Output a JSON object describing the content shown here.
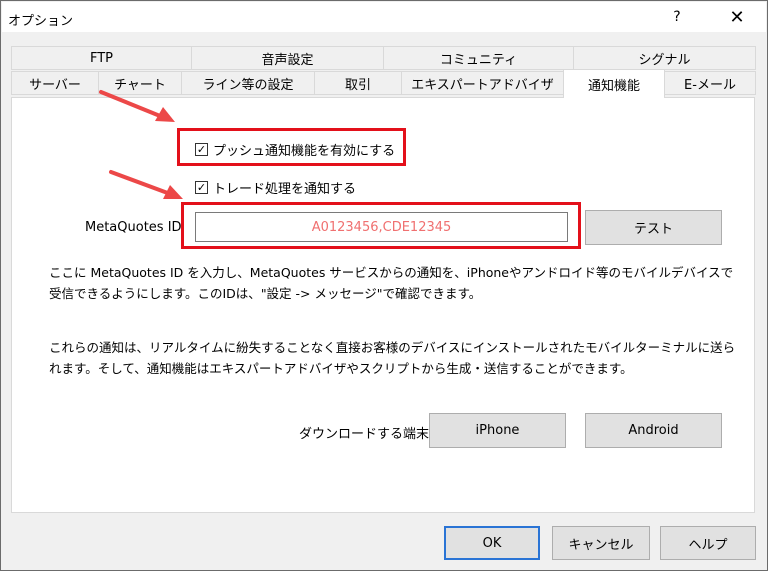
{
  "window": {
    "title": "オプション",
    "help_glyph": "?",
    "close_glyph": "✕"
  },
  "tabs": {
    "row_top": [
      "FTP",
      "音声設定",
      "コミュニティ",
      "シグナル"
    ],
    "row_bottom": [
      "サーバー",
      "チャート",
      "ライン等の設定",
      "取引",
      "エキスパートアドバイザ",
      "通知機能",
      "E-メール"
    ],
    "active": "通知機能"
  },
  "notifications": {
    "enable_push_label": "プッシュ通知機能を有効にする",
    "enable_push_checked": true,
    "notify_trades_label": "トレード処理を通知する",
    "notify_trades_checked": true,
    "metaquotes_id_label": "MetaQuotes ID",
    "metaquotes_id_value": "A0123456,CDE12345",
    "test_button": "テスト",
    "info_paragraph_1": "ここに MetaQuotes ID を入力し、MetaQuotes サービスからの通知を、iPhoneやアンドロイド等のモバイルデバイスで受信できるようにします。このIDは、\"設定 -> メッセージ\"で確認できます。",
    "info_paragraph_2": "これらの通知は、リアルタイムに紛失することなく直接お客様のデバイスにインストールされたモバイルターミナルに送られます。そして、通知機能はエキスパートアドバイザやスクリプトから生成・送信することができます。",
    "download_label": "ダウンロードする端末:",
    "iphone_button": "iPhone",
    "android_button": "Android"
  },
  "footer": {
    "ok": "OK",
    "cancel": "キャンセル",
    "help": "ヘルプ"
  },
  "colors": {
    "highlight": "#e3101a",
    "arrow": "#ec4848",
    "id_text": "#f07070",
    "default_button_border": "#2a74d5"
  },
  "check_glyph": "✓"
}
